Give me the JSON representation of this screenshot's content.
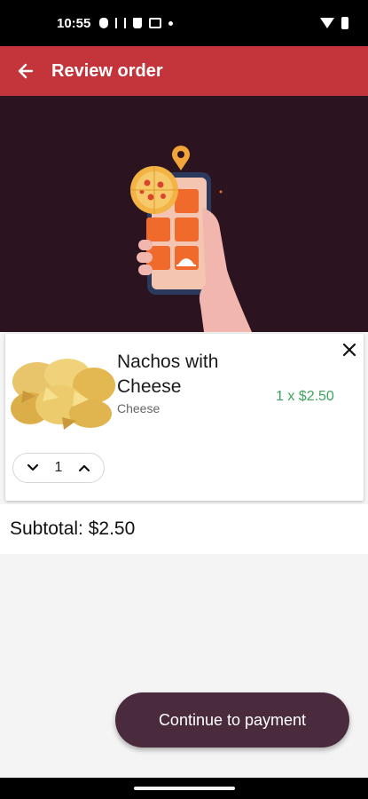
{
  "status_bar": {
    "time": "10:55",
    "icons": [
      "notification-icon",
      "signal-icon",
      "cup-icon",
      "m-icon",
      "dot-icon",
      "wifi-icon",
      "battery-icon"
    ]
  },
  "app_bar": {
    "title": "Review order",
    "back_icon": "arrow-left-icon",
    "color": "#c3353a"
  },
  "banner": {
    "background": "#2c1320",
    "illustration": "hand-phone-pizza-illustration"
  },
  "cart_item": {
    "name": "Nachos with Cheese",
    "variant": "Cheese",
    "price_line": "1 x $2.50",
    "quantity": "1",
    "remove_icon": "close-icon",
    "image": "nachos-image"
  },
  "subtotal": {
    "text": "Subtotal: $2.50"
  },
  "actions": {
    "continue_label": "Continue to payment",
    "color": "#4a2b3d"
  },
  "colors": {
    "price_green": "#3da35d",
    "accent_orange": "#f06a2b"
  }
}
